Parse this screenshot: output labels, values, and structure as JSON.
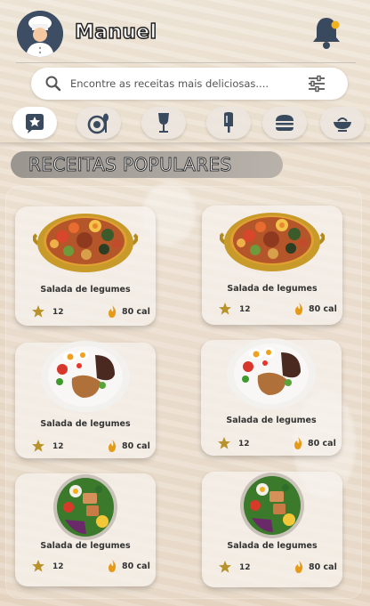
{
  "header": {
    "username": "Manuel"
  },
  "search": {
    "placeholder": "Encontre as receitas mais deliciosas...."
  },
  "categories": [
    "favoritos",
    "pratos",
    "bebidas",
    "sorvetes",
    "lanches",
    "sobremesas"
  ],
  "section": {
    "title": "RECEITAS POPULARES"
  },
  "recipes": [
    {
      "name": "Salada de legumes",
      "rating": "12",
      "calories": "80 cal",
      "dish": "paella"
    },
    {
      "name": "Salada de legumes",
      "rating": "12",
      "calories": "80 cal",
      "dish": "paella"
    },
    {
      "name": "Salada de legumes",
      "rating": "12",
      "calories": "80 cal",
      "dish": "plate"
    },
    {
      "name": "Salada de legumes",
      "rating": "12",
      "calories": "80 cal",
      "dish": "plate"
    },
    {
      "name": "Salada de legumes",
      "rating": "12",
      "calories": "80 cal",
      "dish": "bowl"
    },
    {
      "name": "Salada de legumes",
      "rating": "12",
      "calories": "80 cal",
      "dish": "bowl"
    }
  ],
  "colors": {
    "accent_star": "#b8922a",
    "flame": "#e59a18",
    "bell_dot": "#f1b21c"
  }
}
